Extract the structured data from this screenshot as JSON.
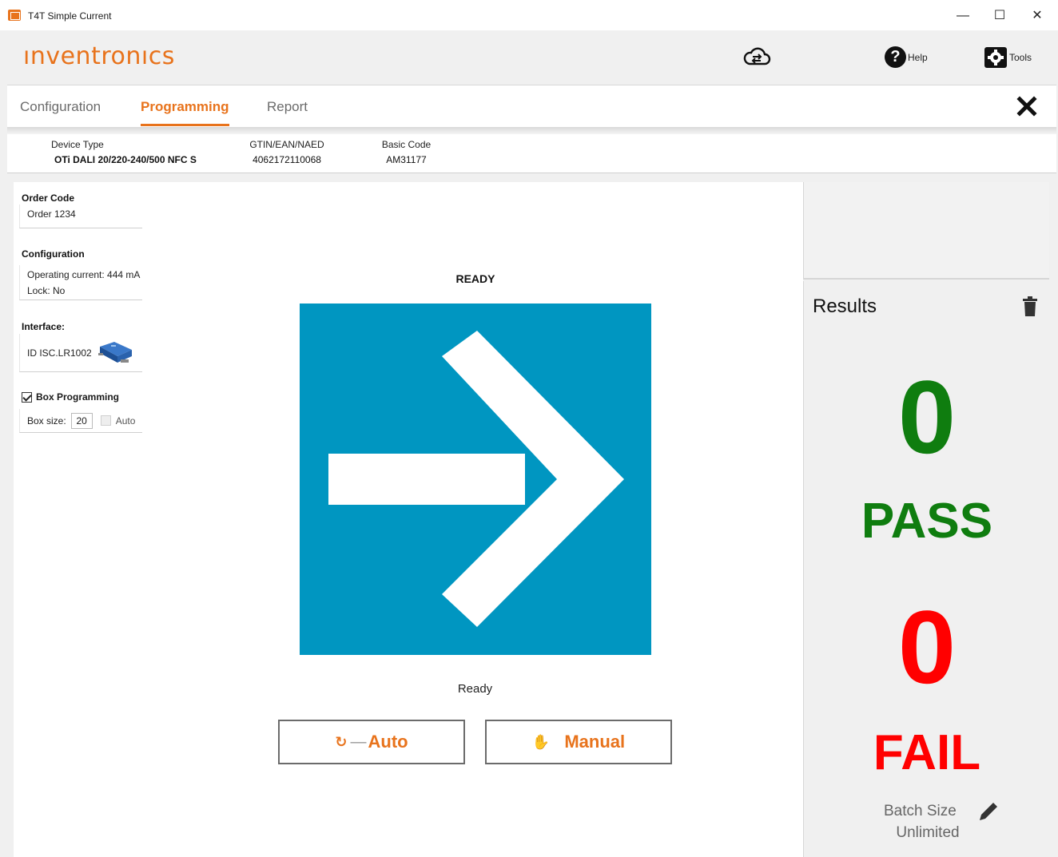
{
  "window": {
    "title": "T4T Simple Current",
    "minimize_glyph": "—",
    "maximize_glyph": "☐",
    "close_glyph": "✕"
  },
  "header": {
    "logo": "ınventronıcs",
    "help_label": "Help",
    "tools_label": "Tools",
    "help_glyph": "?"
  },
  "tabs": [
    {
      "label": "Configuration"
    },
    {
      "label": "Programming"
    },
    {
      "label": "Report"
    }
  ],
  "device": {
    "device_type_label": "Device Type",
    "device_type_value": "OTi DALI 20/220-240/500 NFC S",
    "gtin_label": "GTIN/EAN/NAED",
    "gtin_value": "4062172110068",
    "basic_label": "Basic Code",
    "basic_value": "AM31177"
  },
  "sidebar": {
    "order_code_title": "Order Code",
    "order_code_value": "Order 1234",
    "configuration_title": "Configuration",
    "operating_current": "Operating current: 444 mA",
    "lock": "Lock: No",
    "interface_title": "Interface:",
    "interface_value": "ID ISC.LR1002",
    "box_programming_label": "Box Programming",
    "box_programming_checked": true,
    "box_size_label": "Box size:",
    "box_size_value": "20",
    "auto_label": "Auto"
  },
  "status": {
    "title": "READY",
    "text": "Ready",
    "color": "#0096c1"
  },
  "actions": {
    "auto_label": "Auto",
    "manual_label": "Manual",
    "auto_icon_glyph": "↻",
    "manual_icon_glyph": "✋",
    "dash": "—"
  },
  "results": {
    "title": "Results",
    "pass_count": "0",
    "pass_label": "PASS",
    "fail_count": "0",
    "fail_label": "FAIL",
    "batch_size_label": "Batch Size",
    "batch_size_value": "Unlimited"
  },
  "colors": {
    "accent": "#e8731c",
    "pass": "#0f7d0f",
    "fail": "#ff0000"
  }
}
